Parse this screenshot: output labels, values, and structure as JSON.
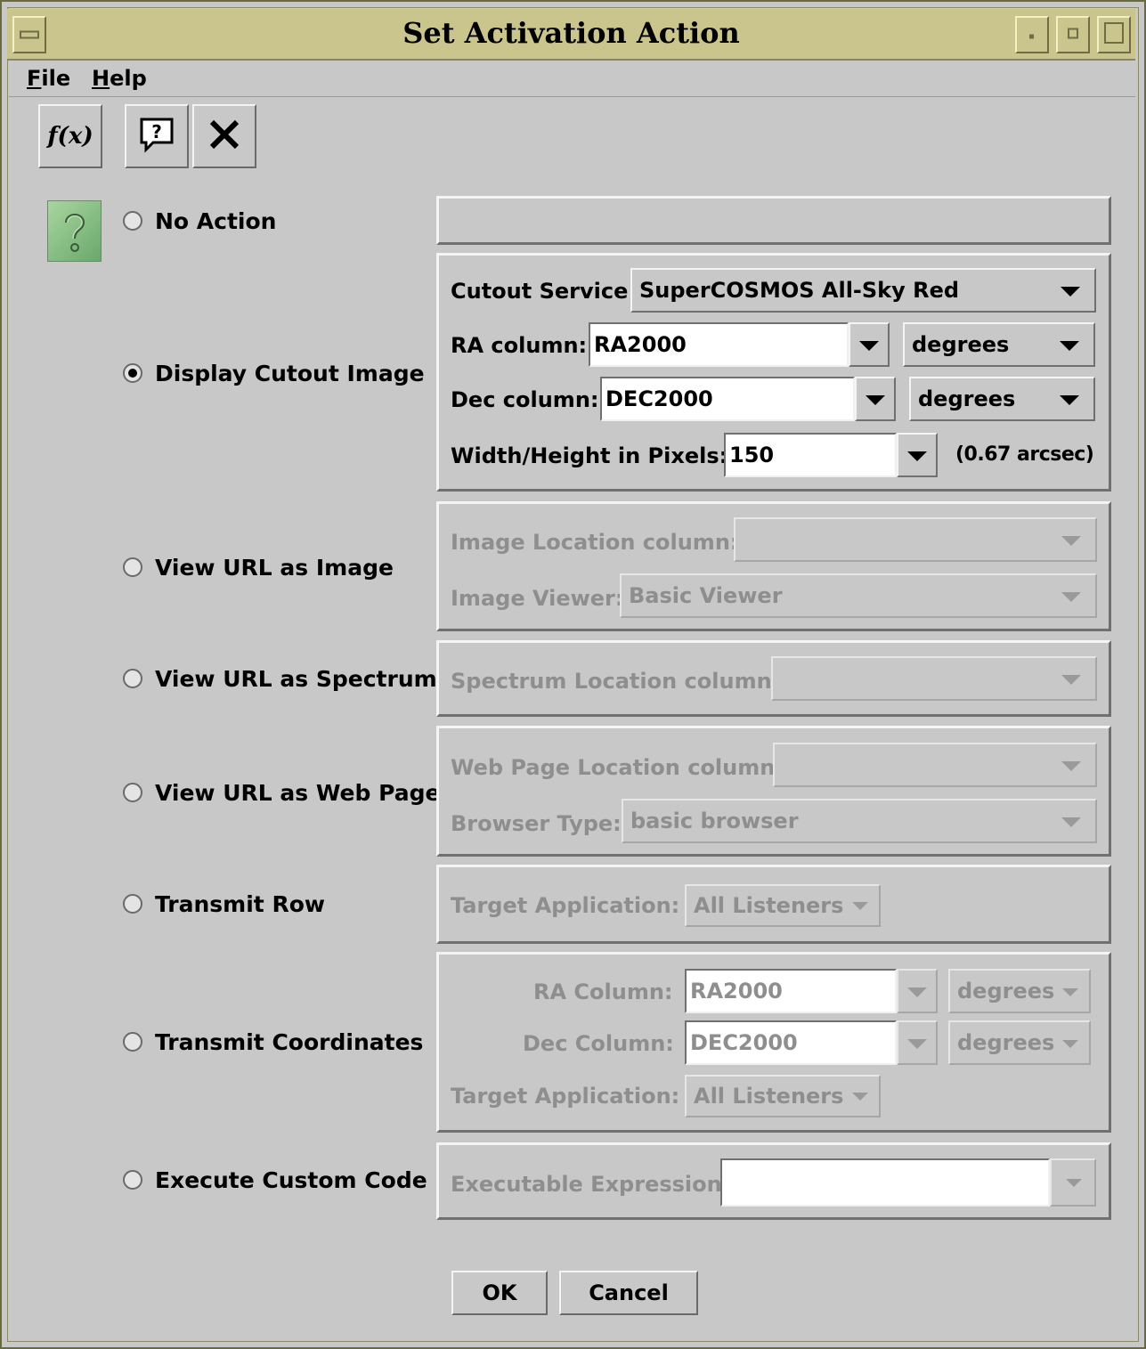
{
  "window": {
    "title": "Set Activation Action"
  },
  "menu": {
    "file": "File",
    "file_mnemonic": "F",
    "file_rest": "ile",
    "help": "Help",
    "help_mnemonic": "H",
    "help_rest": "elp"
  },
  "toolbar": {
    "function_label": "f(x)"
  },
  "actions": [
    {
      "label": "No Action",
      "selected": false
    },
    {
      "label": "Display Cutout Image",
      "selected": true
    },
    {
      "label": "View URL as Image",
      "selected": false
    },
    {
      "label": "View URL as Spectrum",
      "selected": false
    },
    {
      "label": "View URL as Web Page",
      "selected": false
    },
    {
      "label": "Transmit Row",
      "selected": false
    },
    {
      "label": "Transmit Coordinates",
      "selected": false
    },
    {
      "label": "Execute Custom Code",
      "selected": false
    }
  ],
  "cutout": {
    "service_label": "Cutout Service:",
    "service_value": "SuperCOSMOS All-Sky Red",
    "ra_label": "RA column:",
    "ra_value": "RA2000",
    "ra_unit": "degrees",
    "dec_label": "Dec column:",
    "dec_value": "DEC2000",
    "dec_unit": "degrees",
    "size_label": "Width/Height in Pixels:",
    "size_value": "150",
    "size_note": "(0.67 arcsec)"
  },
  "image": {
    "location_label": "Image Location column:",
    "location_value": "",
    "viewer_label": "Image Viewer:",
    "viewer_value": "Basic Viewer"
  },
  "spectrum": {
    "location_label": "Spectrum Location column:",
    "location_value": ""
  },
  "webpage": {
    "location_label": "Web Page Location column:",
    "location_value": "",
    "browser_label": "Browser Type:",
    "browser_value": "basic browser"
  },
  "transmit_row": {
    "target_label": "Target Application:",
    "target_value": "All Listeners"
  },
  "transmit_coords": {
    "ra_label": "RA Column:",
    "ra_value": "RA2000",
    "ra_unit": "degrees",
    "dec_label": "Dec Column:",
    "dec_value": "DEC2000",
    "dec_unit": "degrees",
    "target_label": "Target Application:",
    "target_value": "All Listeners"
  },
  "custom": {
    "expr_label": "Executable Expression:",
    "expr_value": ""
  },
  "buttons": {
    "ok": "OK",
    "cancel": "Cancel"
  },
  "icons": {
    "function": "function-icon",
    "help": "help-bubble-icon",
    "close": "close-x-icon",
    "help_large": "question-mark-icon"
  }
}
